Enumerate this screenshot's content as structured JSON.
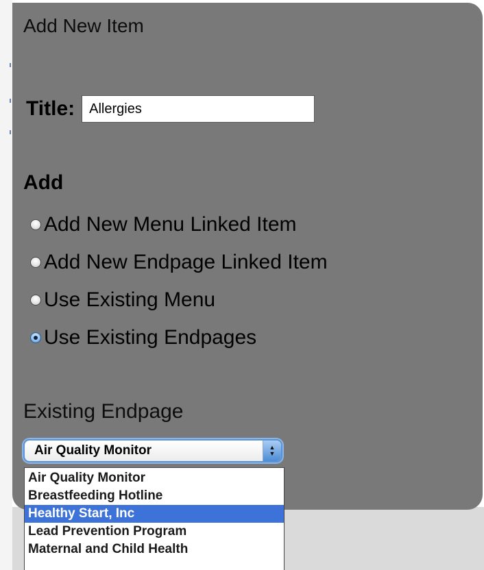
{
  "panel": {
    "title": "Add New Item"
  },
  "form": {
    "title_label": "Title:",
    "title_value": "Allergies",
    "add_heading": "Add",
    "radio_options": [
      {
        "label": "Add New Menu Linked Item",
        "checked": false
      },
      {
        "label": "Add New Endpage Linked Item",
        "checked": false
      },
      {
        "label": "Use Existing Menu",
        "checked": false
      },
      {
        "label": "Use Existing Endpages",
        "checked": true
      }
    ],
    "existing_label": "Existing Endpage",
    "select_value": "Air Quality Monitor",
    "dropdown_options": [
      {
        "label": "Air Quality Monitor",
        "highlighted": false
      },
      {
        "label": "Breastfeeding Hotline",
        "highlighted": false
      },
      {
        "label": "Healthy Start, Inc",
        "highlighted": true
      },
      {
        "label": "Lead Prevention Program",
        "highlighted": false
      },
      {
        "label": "Maternal and Child Health",
        "highlighted": false
      }
    ]
  },
  "icons": {
    "select_arrows": "up-down-arrows-icon",
    "radio": "radio-button-icon"
  },
  "colors": {
    "panel_bg": "#797979",
    "highlight": "#3d72d8",
    "select_focus": "#5b94d6"
  }
}
